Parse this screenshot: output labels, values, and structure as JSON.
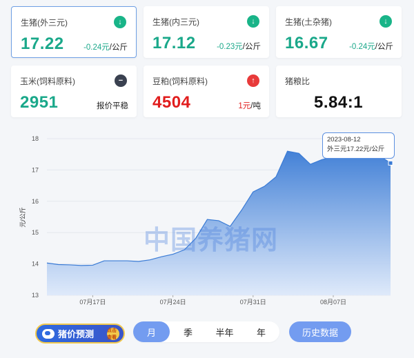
{
  "cards": [
    {
      "title": "生猪(外三元)",
      "value": "17.22",
      "change": "-0.24元",
      "unit": "/公斤",
      "trend": "down"
    },
    {
      "title": "生猪(内三元)",
      "value": "17.12",
      "change": "-0.23元",
      "unit": "/公斤",
      "trend": "down"
    },
    {
      "title": "生猪(土杂猪)",
      "value": "16.67",
      "change": "-0.24元",
      "unit": "/公斤",
      "trend": "down"
    },
    {
      "title": "玉米(饲料原料)",
      "value": "2951",
      "change": "报价平稳",
      "unit": "",
      "trend": "flat"
    },
    {
      "title": "豆粕(饲料原料)",
      "value": "4504",
      "change": "1元",
      "unit": "/吨",
      "trend": "up"
    },
    {
      "title": "猪粮比",
      "value": "5.84:1",
      "change": "",
      "unit": "",
      "trend": "none"
    }
  ],
  "icons": {
    "down": "arrow-down-icon",
    "up": "arrow-up-icon",
    "flat": "minus-icon"
  },
  "colors": {
    "down": "#19b488",
    "up": "#e83a3a",
    "flat": "#3a4150",
    "line": "#3a7bd5",
    "accent": "#739cf0"
  },
  "chart_data": {
    "type": "area",
    "ylabel": "元/公斤",
    "ylim": [
      13,
      18
    ],
    "yticks": [
      "18",
      "17",
      "16",
      "15",
      "14",
      "13"
    ],
    "xtick_labels": [
      "07月17日",
      "07月24日",
      "07月31日",
      "08月07日"
    ],
    "x": [
      "2023-07-13",
      "2023-07-14",
      "2023-07-15",
      "2023-07-16",
      "2023-07-17",
      "2023-07-18",
      "2023-07-19",
      "2023-07-20",
      "2023-07-21",
      "2023-07-22",
      "2023-07-23",
      "2023-07-24",
      "2023-07-25",
      "2023-07-26",
      "2023-07-27",
      "2023-07-28",
      "2023-07-29",
      "2023-07-30",
      "2023-07-31",
      "2023-08-01",
      "2023-08-02",
      "2023-08-03",
      "2023-08-04",
      "2023-08-05",
      "2023-08-06",
      "2023-08-07",
      "2023-08-08",
      "2023-08-09",
      "2023-08-10",
      "2023-08-11",
      "2023-08-12"
    ],
    "series": [
      {
        "name": "外三元",
        "values": [
          14.03,
          13.98,
          13.97,
          13.95,
          13.96,
          14.1,
          14.1,
          14.1,
          14.08,
          14.13,
          14.23,
          14.31,
          14.45,
          14.82,
          15.42,
          15.38,
          15.2,
          15.72,
          16.3,
          16.48,
          16.78,
          17.6,
          17.53,
          17.18,
          17.33,
          17.42,
          17.5,
          17.48,
          17.45,
          17.46,
          17.22
        ]
      }
    ],
    "grid": true,
    "tooltip": {
      "date": "2023-08-12",
      "text": "外三元17.22元/公斤"
    }
  },
  "watermark": "中国养猪网",
  "promo": {
    "label": "猪价预测",
    "badge": "点击查看"
  },
  "periods": [
    "月",
    "季",
    "半年",
    "年"
  ],
  "selected_period": "月",
  "history_button": "历史数据"
}
